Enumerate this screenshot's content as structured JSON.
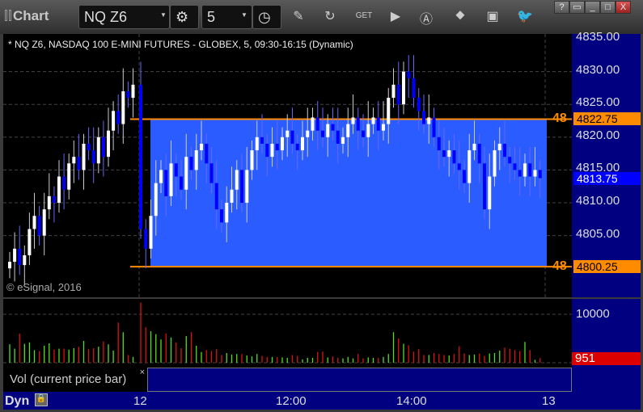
{
  "toolbar": {
    "title": "Chart",
    "symbol": "NQ Z6",
    "interval": "5",
    "icons": [
      "settings-gear-icon",
      "clock-icon",
      "pencil-icon",
      "study-icon",
      "get-icon",
      "play-icon",
      "alert-icon",
      "link-icon",
      "comment-icon",
      "twitter-icon"
    ],
    "window_buttons": [
      "?",
      "▭",
      "_",
      "□",
      "X"
    ]
  },
  "chart": {
    "header": "* NQ Z6, NASDAQ 100 E-MINI FUTURES - GLOBEX, 5, 09:30-16:15 (Dynamic)",
    "copyright": "© eSignal, 2016",
    "price_ticks": [
      "4835.00",
      "4830.00",
      "4825.00",
      "4820.00",
      "4815.00",
      "4810.00",
      "4805.00"
    ],
    "last_price": "4813.75",
    "upper_level": "4822.75",
    "lower_level": "4800.25",
    "level_label": "48",
    "colors": {
      "up": "#ffffff",
      "down": "#0000ff",
      "zone": "#2a5cff",
      "level": "#ff8c00",
      "vol_up": "#55dd22",
      "vol_down": "#dd1111"
    },
    "closes": [
      4801,
      4803,
      4800.5,
      4802,
      4806,
      4808,
      4805,
      4809,
      4811,
      4810,
      4814,
      4812,
      4816,
      4817,
      4815,
      4819,
      4818,
      4816,
      4820,
      4817,
      4821,
      4824,
      4822,
      4827,
      4826,
      4828,
      4806,
      4803,
      4808,
      4813,
      4815,
      4811,
      4816,
      4814,
      4812,
      4817,
      4815,
      4818,
      4819,
      4816,
      4813,
      4809,
      4807,
      4810,
      4812,
      4815,
      4810,
      4815,
      4818,
      4820,
      4819,
      4817,
      4819,
      4818,
      4820,
      4821,
      4819,
      4818,
      4820,
      4821,
      4823,
      4821,
      4820,
      4822,
      4821,
      4819,
      4820,
      4822,
      4823,
      4821,
      4820,
      4822,
      4823,
      4821,
      4822,
      4826,
      4828,
      4825,
      4830,
      4829,
      4826,
      4824,
      4822,
      4823,
      4820,
      4818,
      4817,
      4818,
      4816,
      4815,
      4813,
      4818,
      4819,
      4816,
      4809,
      4814,
      4818,
      4819,
      4817,
      4816,
      4815,
      4814,
      4816,
      4814,
      4815,
      4813.75
    ],
    "volumes": [
      3800,
      2900,
      6000,
      3900,
      4200,
      2600,
      2400,
      3500,
      4000,
      2700,
      2900,
      2900,
      2700,
      3000,
      3300,
      4500,
      2800,
      3000,
      3300,
      4400,
      3800,
      2500,
      8300,
      6300,
      1600,
      1200,
      12400,
      7300,
      6500,
      5900,
      4800,
      6000,
      5200,
      4200,
      3000,
      5500,
      6300,
      3500,
      2200,
      2600,
      2400,
      2800,
      1600,
      2000,
      1700,
      1800,
      1800,
      1500,
      1300,
      1800,
      1400,
      1200,
      1200,
      1200,
      1100,
      1000,
      1600,
      1400,
      700,
      1000,
      1000,
      2200,
      2300,
      1100,
      1300,
      1000,
      900,
      1200,
      900,
      1800,
      900,
      1100,
      1000,
      1000,
      1200,
      1800,
      6300,
      5000,
      3900,
      3600,
      2300,
      2800,
      1600,
      1600,
      2000,
      1800,
      1600,
      1500,
      1800,
      3400,
      1900,
      1600,
      1700,
      1900,
      1400,
      1900,
      2000,
      2500,
      3100,
      2900,
      2600,
      2400,
      4300,
      2600,
      600,
      951
    ],
    "volume_tick": "10000",
    "volume_last": "951",
    "volume_zero": "0",
    "legend": "Vol (current price bar)",
    "legend_close": "×",
    "time_ticks": [
      "12",
      "12:00",
      "14:00",
      "13"
    ],
    "mode": "Dyn"
  }
}
